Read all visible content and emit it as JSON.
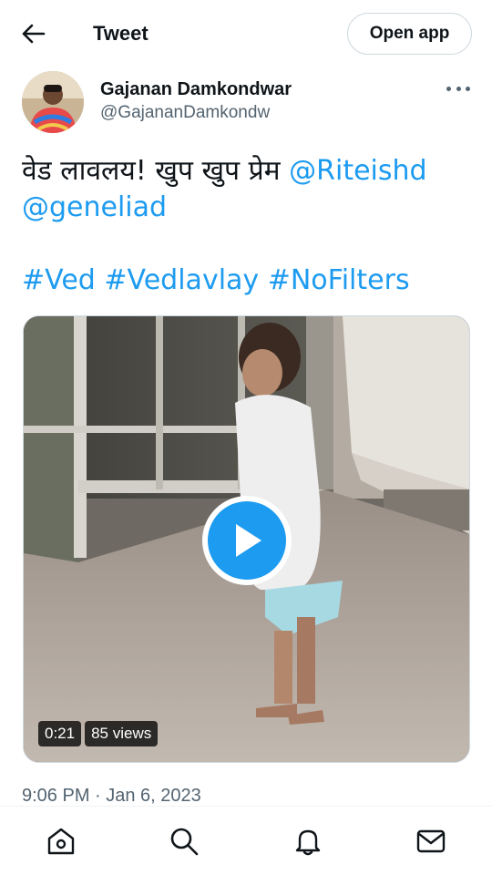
{
  "header": {
    "title": "Tweet",
    "open_app_label": "Open app",
    "back_icon": "arrow-left-icon"
  },
  "author": {
    "name": "Gajanan Damkondwar",
    "handle": "@GajananDamkondw"
  },
  "tweet": {
    "text_prefix": "वेड लावलय! खुप खुप प्रेम ",
    "mention_1": "@Riteishd",
    "mention_2": "@geneliad",
    "hashtag_1": "#Ved",
    "hashtag_2": "#Vedlavlay",
    "hashtag_3": "#NoFilters",
    "timestamp": "9:06 PM · Jan 6, 2023"
  },
  "video": {
    "duration": "0:21",
    "views": "85 views"
  },
  "nav": {
    "icons": [
      "home-icon",
      "search-icon",
      "notifications-icon",
      "messages-icon"
    ]
  },
  "colors": {
    "accent": "#1d9bf0",
    "text": "#0f1419",
    "secondary": "#536471"
  }
}
